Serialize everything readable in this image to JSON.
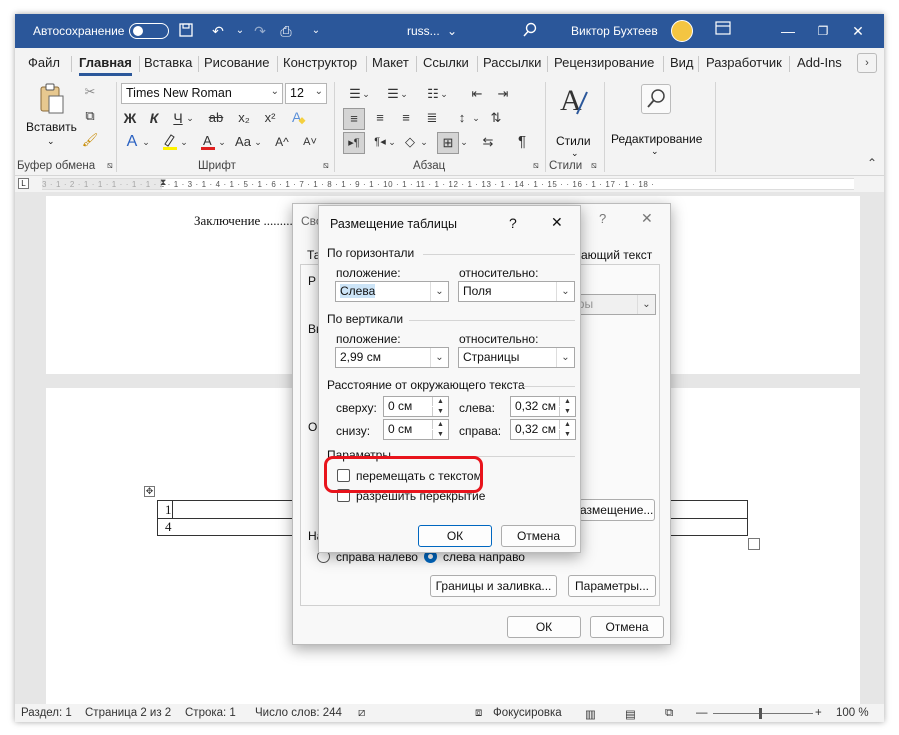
{
  "titlebar": {
    "autosave_label": "Автосохранение",
    "doc_name": "russ...",
    "doc_chevron": "⌄",
    "user": "Виктор Бухтеев"
  },
  "tabs": [
    "Файл",
    "Главная",
    "Вставка",
    "Рисование",
    "Конструктор",
    "Макет",
    "Ссылки",
    "Рассылки",
    "Рецензирование",
    "Вид",
    "Разработчик",
    "Add-Ins"
  ],
  "ribbon": {
    "paste_label": "Вставить",
    "clipboard_group": "Буфер обмена",
    "font_name": "Times New Roman",
    "font_size": "12",
    "font_group": "Шрифт",
    "bold": "Ж",
    "italic": "К",
    "underline": "Ч",
    "strike": "ab",
    "sub": "x₂",
    "sup": "x²",
    "case": "Аа",
    "grow": "A^",
    "shrink": "A˅",
    "paragraph_group": "Абзац",
    "styles_label": "Стили",
    "styles_group": "Стили",
    "editing_label": "Редактирование"
  },
  "ruler_text": "3 · 1 · 2 · 1 · 1 · 1 ·  · 1 · 1 · 2 · 1 · 3 · 1 · 4 · 1 · 5 · 1 · 6 · 1 · 7 · 1 · 8 · 1 · 9 · 1 · 10 · 1 · 11 · 1 · 12 · 1 · 13 · 1 · 14 · 1 · 15 ·  · 16 · 1 · 17 · 1 · 18 ·",
  "document": {
    "toc_line": "Заключение ....................................................................................................................... 1",
    "table_cells": [
      "1",
      "4"
    ]
  },
  "back_dialog": {
    "title_partial": "Сво",
    "tab_partial_left": "Та",
    "tab_partial_right": "ающий текст",
    "p_partial": "Р",
    "v_partial": "Вы",
    "o_partial": "О",
    "na_partial": "На",
    "combo_partial": "етры",
    "placement_btn": "азмещение...",
    "rtl_label": "справа налево",
    "ltr_label": "слева направо",
    "borders_btn": "Границы и заливка...",
    "params_btn": "Параметры...",
    "ok": "ОК",
    "cancel": "Отмена"
  },
  "dialog": {
    "title": "Размещение таблицы",
    "help": "?",
    "close": "✕",
    "horiz_section": "По горизонтали",
    "horiz_pos_label": "положение:",
    "horiz_pos_value": "Слева",
    "horiz_rel_label": "относительно:",
    "horiz_rel_value": "Поля",
    "vert_section": "По вертикали",
    "vert_pos_label": "положение:",
    "vert_pos_value": "2,99 см",
    "vert_rel_label": "относительно:",
    "vert_rel_value": "Страницы",
    "dist_section": "Расстояние от окружающего текста",
    "top_label": "сверху:",
    "top_value": "0 см",
    "left_label": "слева:",
    "left_value": "0,32 см",
    "bottom_label": "снизу:",
    "bottom_value": "0 см",
    "right_label": "справа:",
    "right_value": "0,32 см",
    "params_section": "Параметры",
    "move_with_text": "перемещать с текстом",
    "allow_overlap": "разрешить перекрытие",
    "ok": "ОК",
    "cancel": "Отмена",
    "highlight_color": "#e8141c"
  },
  "status": {
    "section": "Раздел: 1",
    "page": "Страница 2 из 2",
    "line": "Строка: 1",
    "words": "Число слов: 244",
    "focus": "Фокусировка",
    "zoom": "100 %"
  }
}
